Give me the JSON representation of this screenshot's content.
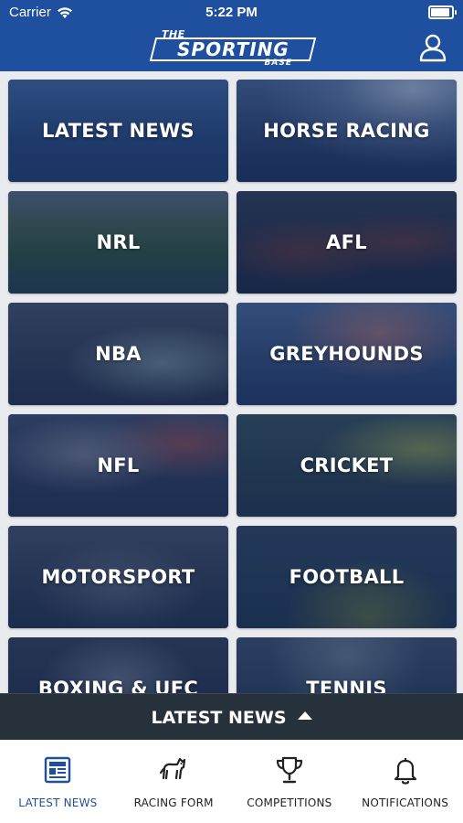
{
  "status": {
    "carrier": "Carrier",
    "time": "5:22 PM"
  },
  "brand": {
    "top": "THE",
    "main": "SPORTING",
    "bottom": "BASE"
  },
  "categories": [
    {
      "label": "LATEST NEWS"
    },
    {
      "label": "HORSE RACING"
    },
    {
      "label": "NRL"
    },
    {
      "label": "AFL"
    },
    {
      "label": "NBA"
    },
    {
      "label": "GREYHOUNDS"
    },
    {
      "label": "NFL"
    },
    {
      "label": "CRICKET"
    },
    {
      "label": "MOTORSPORT"
    },
    {
      "label": "FOOTBALL"
    },
    {
      "label": "BOXING & UFC"
    },
    {
      "label": "TENNIS"
    }
  ],
  "section_bar": {
    "title": "LATEST NEWS"
  },
  "tabs": [
    {
      "label": "LATEST NEWS",
      "icon": "newspaper-icon",
      "active": true
    },
    {
      "label": "RACING FORM",
      "icon": "horse-icon",
      "active": false
    },
    {
      "label": "COMPETITIONS",
      "icon": "trophy-icon",
      "active": false
    },
    {
      "label": "NOTIFICATIONS",
      "icon": "bell-icon",
      "active": false
    }
  ],
  "colors": {
    "brand": "#1f4f9f",
    "section_bar": "#27313b",
    "tab_active": "#1f4f9f"
  }
}
